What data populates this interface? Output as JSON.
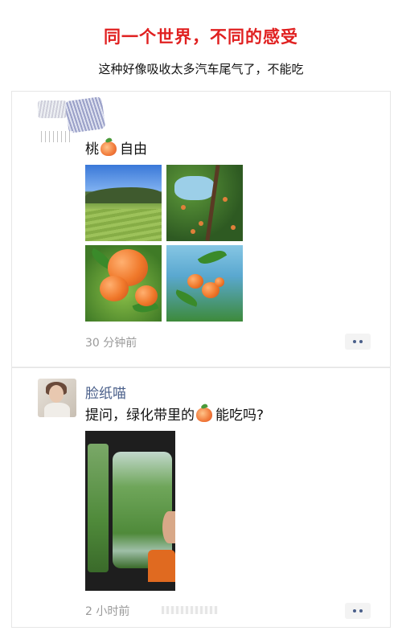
{
  "header": {
    "title": "同一个世界，不同的感受",
    "subtitle": "这种好像吸收太多汽车尾气了，不能吃"
  },
  "post1": {
    "text_before": "桃",
    "text_after": "自由",
    "emoji": "peach-emoji",
    "time": "30 分钟前"
  },
  "post2": {
    "username": "脸纸喵",
    "text_before": "提问，绿化带里的",
    "text_after": "能吃吗?",
    "emoji": "peach-emoji",
    "time": "2 小时前"
  },
  "colors": {
    "title": "#e02020",
    "username": "#4a5f8a",
    "meta": "#9a9a9a"
  }
}
